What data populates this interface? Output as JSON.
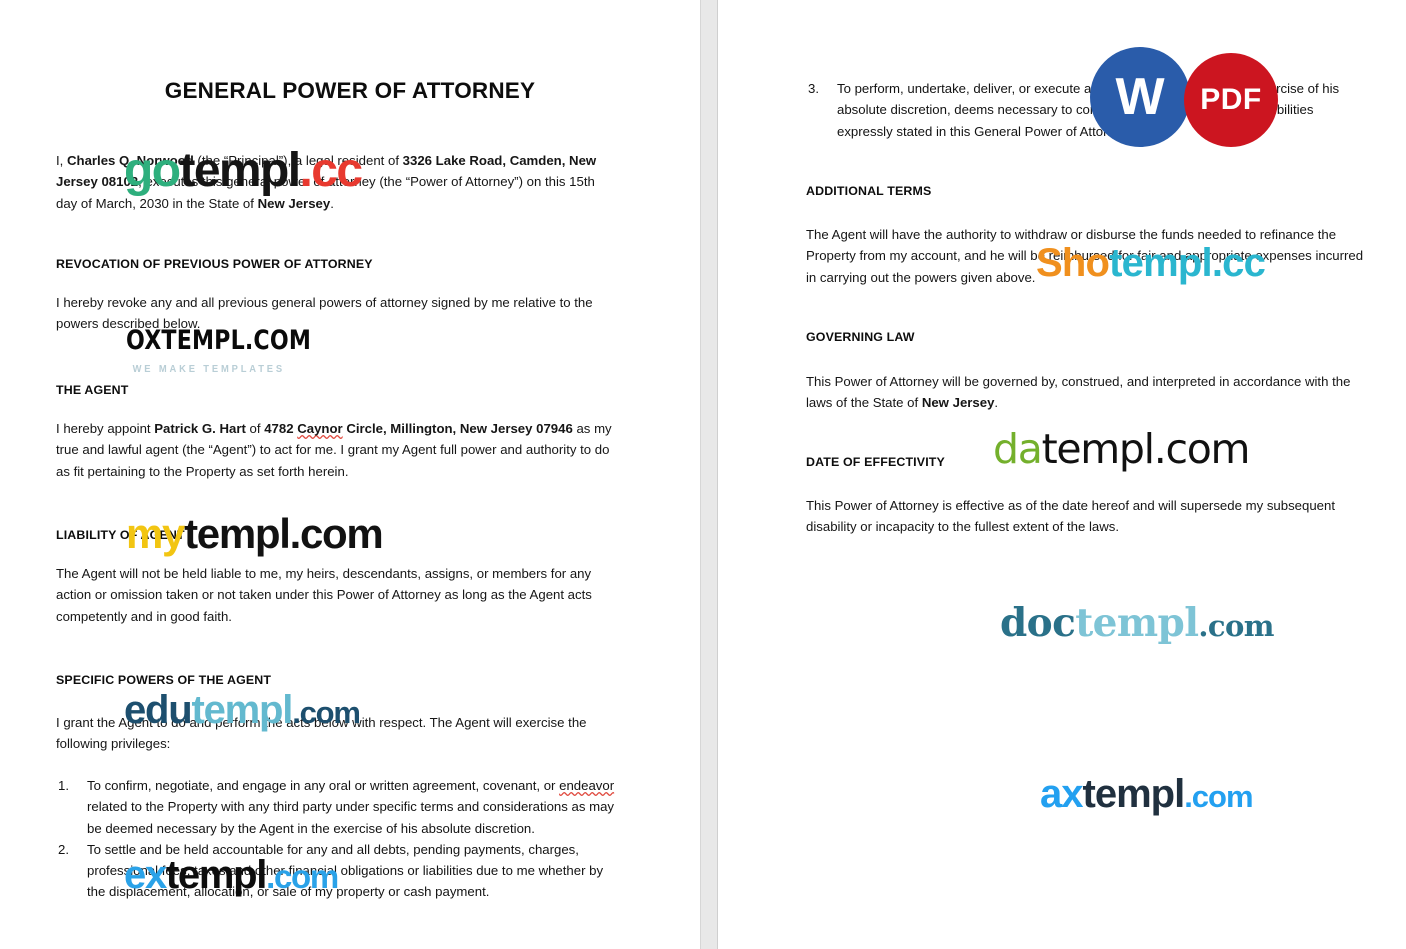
{
  "document": {
    "title": "GENERAL POWER OF ATTORNEY",
    "left_page": {
      "intro": {
        "lead": "I, ",
        "principal_name": "Charles Q. Norwood",
        "mid_1": " (the “Principal”), a legal resident of ",
        "principal_address": "3326 Lake Road, Camden, New Jersey 08102",
        "mid_2": ", executes this general power of attorney (the “Power of Attorney”) on this 15th day of March, 2030 in the State of ",
        "state": "New Jersey",
        "end": "."
      },
      "revocation": {
        "heading": "REVOCATION OF PREVIOUS POWER OF ATTORNEY",
        "body": "I hereby revoke any and all previous general powers of attorney signed by me relative to the powers described below."
      },
      "agent": {
        "heading": "THE AGENT",
        "body_1": "I hereby appoint ",
        "agent_name": "Patrick G. Hart",
        "body_2": " of ",
        "agent_address_1": "4782 ",
        "agent_address_misspelled": "Caynor",
        "agent_address_2": " Circle, Millington, New Jersey 07946",
        "body_3": " as my true and lawful agent (the “Agent”) to act for me. I grant my Agent full power and authority to do as fit pertaining to the Property as set forth herein."
      },
      "liability": {
        "heading": "LIABILITY OF AGENT",
        "body": "The Agent will not be held liable to me, my heirs, descendants, assigns, or members for any action or omission taken or not taken under this Power of Attorney as long as the Agent acts competently and in good faith."
      },
      "specific_powers": {
        "heading": "SPECIFIC POWERS OF THE AGENT",
        "body": "I grant the Agent to do and perform the acts below with respect. The Agent will exercise the following privileges:",
        "items": [
          {
            "number": "1.",
            "text_1": "To confirm, negotiate, and engage in any oral or written agreement, covenant, or ",
            "misspelled": "endeavor",
            "text_2": " related to the Property with any third party under specific terms and considerations as may be deemed necessary by the Agent in the exercise of his absolute discretion."
          },
          {
            "number": "2.",
            "text_1": "To settle and be held accountable for any and all debts, pending payments, charges, professional fees, taxes and other financial obligations or liabilities due to me whether by the displacement, allocation, or sale of my property or cash payment.",
            "misspelled": "",
            "text_2": ""
          }
        ]
      }
    },
    "right_page": {
      "specific_powers_continued": {
        "items": [
          {
            "number": "3.",
            "text": "To perform, undertake, deliver, or execute any act that the Agent, in the exercise of his absolute discretion, deems necessary to complete the powers and responsibilities expressly stated in this General Power of Attorney."
          }
        ]
      },
      "additional_terms": {
        "heading": "ADDITIONAL TERMS",
        "body": "The Agent will have the authority to withdraw or disburse the funds needed to refinance the Property from my account, and he will be reimbursed for fair and appropriate expenses incurred in carrying out the powers given above."
      },
      "governing_law": {
        "heading": "GOVERNING LAW",
        "body_1": "This Power of Attorney will be governed by, construed, and interpreted in accordance with the laws of the State of ",
        "state": "New Jersey",
        "body_2": "."
      },
      "date_of_effectivity": {
        "heading": "DATE OF EFFECTIVITY",
        "body": "This Power of Attorney is effective as of the date hereof and will supersede my subsequent disability or incapacity to the fullest extent of the laws."
      }
    }
  },
  "badges": {
    "word": {
      "label": "W",
      "color": "#2a5caa"
    },
    "pdf": {
      "label": "PDF",
      "color": "#cc1520"
    }
  },
  "watermarks": {
    "gotempl": {
      "part_a": "go",
      "part_b": "templ",
      "part_c": ".cc",
      "colors": [
        "#2eaf7d",
        "#151515",
        "#e8392f"
      ]
    },
    "oxtempl": {
      "main": "OXTEMPL.COM",
      "tagline": "WE MAKE TEMPLATES",
      "colors": [
        "#0a0a0a",
        "#b9ced6"
      ]
    },
    "mytempl": {
      "part_a": "my",
      "part_b": "templ.com",
      "colors": [
        "#f2c512",
        "#121212"
      ]
    },
    "edutempl": {
      "part_a": "edu",
      "part_b": "templ",
      "part_c": ".com",
      "colors": [
        "#1d4f6e",
        "#63b9cf",
        "#1d4f6e"
      ]
    },
    "extempl": {
      "part_a": "ex",
      "part_b": "templ",
      "part_c": ".com",
      "colors": [
        "#2aa2e8",
        "#0d0d0d",
        "#2aa2e8"
      ]
    },
    "shotempl": {
      "part_a": "Sho",
      "part_b": "templ.cc",
      "colors": [
        "#f0901e",
        "#2ab6cf"
      ]
    },
    "datempl": {
      "part_a": "da",
      "part_b": "templ.com",
      "colors": [
        "#74b02c",
        "#111111"
      ]
    },
    "doctempl": {
      "part_a": "doc",
      "part_b": "templ",
      "part_c": ".com",
      "colors": [
        "#2a7189",
        "#7ec4d6",
        "#2a7189"
      ]
    },
    "axtempl": {
      "part_a": "ax",
      "part_b": "templ",
      "part_c": ".com",
      "colors": [
        "#23a0f0",
        "#20303f",
        "#23a0f0"
      ]
    }
  }
}
